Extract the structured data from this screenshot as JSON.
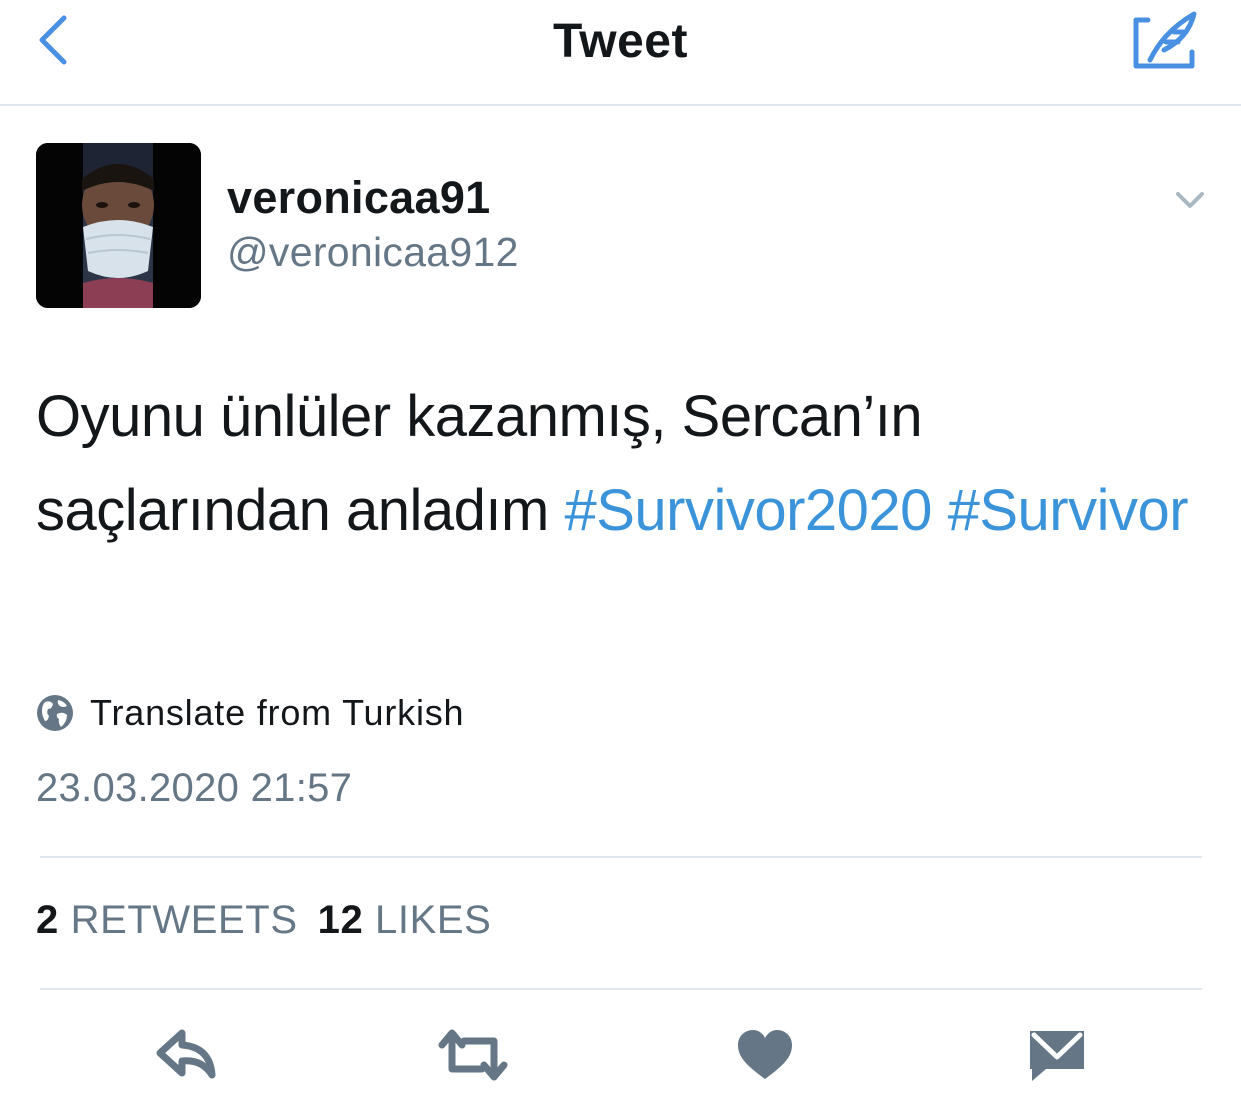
{
  "nav": {
    "title": "Tweet",
    "back_icon": "chevron-left-icon",
    "compose_icon": "compose-quill-icon",
    "accent_color": "#4a90e2"
  },
  "tweet": {
    "author": {
      "display_name": "veronicaa91",
      "handle": "@veronicaa912"
    },
    "text_parts": [
      "Oyunu ünlüler kazanmış, Sercan’ın saçlarından anladım ",
      "#Survivor2020",
      " ",
      "#Survivor"
    ],
    "translate_label": "Translate from Turkish",
    "timestamp": "23.03.2020 21:57",
    "stats": {
      "retweets_count": "2",
      "retweets_label": "RETWEETS",
      "likes_count": "12",
      "likes_label": "LIKES"
    }
  },
  "actions": [
    {
      "icon": "reply-icon"
    },
    {
      "icon": "retweet-icon"
    },
    {
      "icon": "like-heart-icon"
    },
    {
      "icon": "direct-message-icon"
    }
  ],
  "colors": {
    "text": "#14171a",
    "secondary": "#657786",
    "hashtag": "#3b94d9",
    "divider": "#e1e8ed",
    "action_icon": "#657786"
  }
}
